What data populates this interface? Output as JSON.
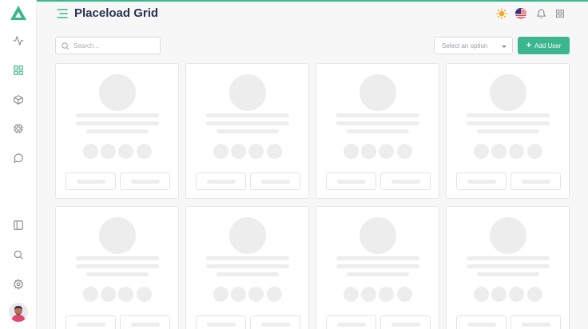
{
  "app": {
    "title": "Placeload Grid",
    "accent_color": "#3cb68e"
  },
  "sidebar": {
    "logo_icon": "triangle-logo-icon",
    "top_items": [
      {
        "name": "activity",
        "icon": "activity-icon"
      },
      {
        "name": "grid",
        "icon": "grid-icon",
        "active": true
      },
      {
        "name": "box",
        "icon": "box-icon"
      },
      {
        "name": "cog",
        "icon": "cog-icon"
      },
      {
        "name": "chat",
        "icon": "chat-icon"
      }
    ],
    "bottom_items": [
      {
        "name": "panel",
        "icon": "sidebar-panel-icon"
      },
      {
        "name": "search",
        "icon": "search-icon"
      },
      {
        "name": "settings",
        "icon": "settings-icon"
      }
    ]
  },
  "header": {
    "icons": [
      "sun-icon",
      "us-flag-icon",
      "bell-icon",
      "apps-grid-icon"
    ]
  },
  "toolbar": {
    "search_placeholder": "Search...",
    "select_placeholder": "Select an option",
    "add_button_label": "Add User"
  },
  "grid": {
    "rows": 2,
    "columns": 4,
    "card_count": 8,
    "placeholder_color": "#ededed"
  }
}
